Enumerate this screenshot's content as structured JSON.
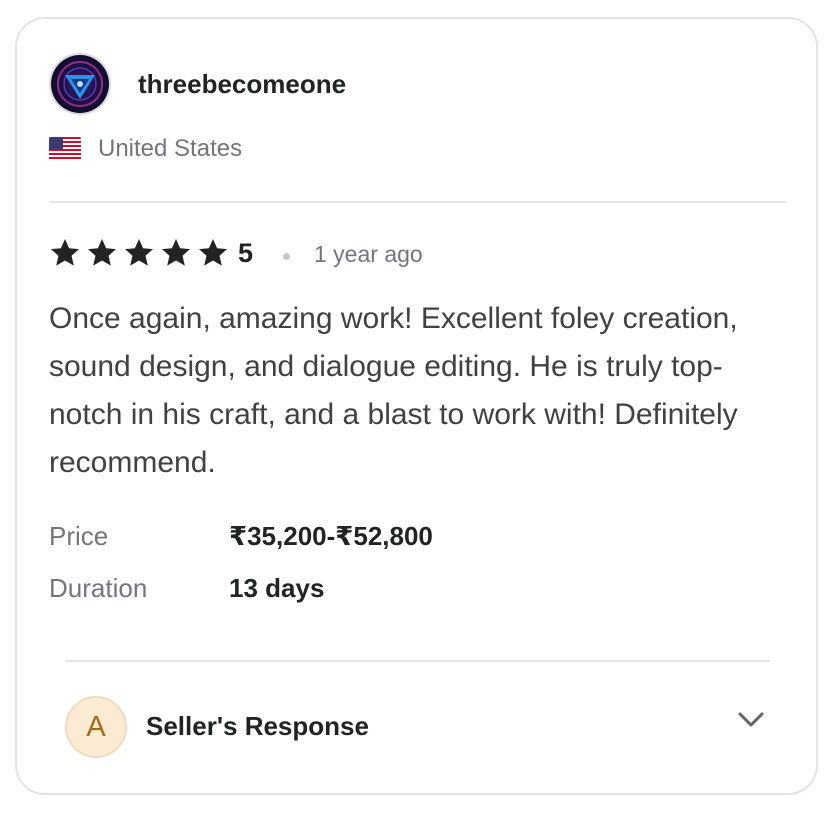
{
  "reviewer": {
    "username": "threebecomeone",
    "country": "United States",
    "avatar_icon": "avatar-icon",
    "flag_icon": "us-flag-icon"
  },
  "review": {
    "stars": 5,
    "rating": "5",
    "time_ago": "1 year ago",
    "text": "Once again, amazing work! Excellent foley creation, sound design, and dialogue editing. He is truly top-notch in his craft, and a blast to work with! Definitely recommend."
  },
  "details": {
    "price_label": "Price",
    "price_value": "₹35,200-₹52,800",
    "duration_label": "Duration",
    "duration_value": "13 days"
  },
  "seller_response": {
    "avatar_letter": "A",
    "label": "Seller's Response",
    "toggle_icon": "chevron-down-icon"
  },
  "colors": {
    "star": "#222325",
    "response_avatar_bg": "#fbebd3",
    "response_avatar_text": "#a56a19"
  }
}
